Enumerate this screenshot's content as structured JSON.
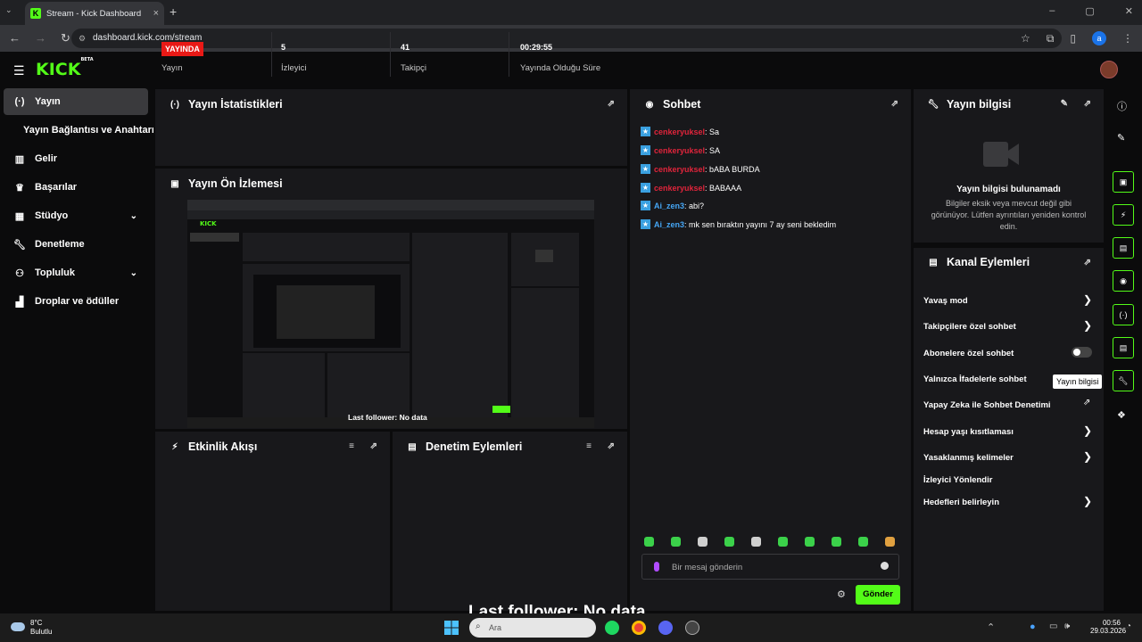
{
  "browser": {
    "tab_title": "Stream - Kick Dashboard",
    "url": "dashboard.kick.com/stream",
    "profile_initial": "a"
  },
  "brand": {
    "logo": "KICK",
    "logo_sup": "BETA",
    "accent": "#53fc18"
  },
  "sidebar": {
    "items": [
      {
        "label": "Yayın",
        "icon": "broadcast-icon"
      },
      {
        "label": "Yayın Bağlantısı ve Anahtarı"
      },
      {
        "label": "Gelir",
        "icon": "chart-icon"
      },
      {
        "label": "Başarılar",
        "icon": "trophy-icon"
      },
      {
        "label": "Stüdyo",
        "icon": "studio-icon"
      },
      {
        "label": "Denetleme",
        "icon": "wrench-icon"
      },
      {
        "label": "Topluluk",
        "icon": "community-icon"
      },
      {
        "label": "Droplar ve ödüller",
        "icon": "drops-icon"
      }
    ]
  },
  "stats": {
    "title": "Yayın İstatistikleri",
    "live_badge": "YAYINDA",
    "items": [
      {
        "value": "",
        "label": "Yayın"
      },
      {
        "value": "5",
        "label": "İzleyici"
      },
      {
        "value": "41",
        "label": "Takipçi"
      },
      {
        "value": "00:29:55",
        "label": "Yayında Olduğu Süre"
      }
    ]
  },
  "preview": {
    "title": "Yayın Ön İzlemesi",
    "overlay": "Last follower: No data"
  },
  "activity": {
    "title": "Etkinlik Akışı"
  },
  "mod_actions": {
    "title": "Denetim Eylemleri"
  },
  "chat": {
    "title": "Sohbet",
    "messages": [
      {
        "user": "cenkeryuksel",
        "text": ": Sa"
      },
      {
        "user": "cenkeryuksel",
        "text": ": SA"
      },
      {
        "user": "cenkeryuksel",
        "text": ": bABA BURDA"
      },
      {
        "user": "cenkeryuksel",
        "text": ": BABAAA"
      },
      {
        "user": "Ai_zen3",
        "text": ": abi?"
      },
      {
        "user": "Ai_zen3",
        "text": ": mk sen bıraktın yayını 7 ay seni bekledim"
      }
    ],
    "placeholder": "Bir mesaj gönderin",
    "send_label": "Gönder"
  },
  "stream_info": {
    "title": "Yayın bilgisi",
    "empty_title": "Yayın bilgisi bulunamadı",
    "empty_text": "Bilgiler eksik veya mevcut değil gibi görünüyor. Lütfen ayrıntıları yeniden kontrol edin."
  },
  "channel_actions": {
    "title": "Kanal Eylemleri",
    "items": [
      "Yavaş mod",
      "Takipçilere özel sohbet",
      "Abonelere özel sohbet",
      "Yalnızca İfadelerle sohbet",
      "Yapay Zeka ile Sohbet Denetimi",
      "Hesap yaşı kısıtlaması",
      "Yasaklanmış kelimeler",
      "İzleyici Yönlendir",
      "Hedefleri belirleyin"
    ]
  },
  "tooltip": "Yayın bilgisi",
  "taskbar": {
    "weather_temp": "8°C",
    "weather_cond": "Bulutlu",
    "search": "Ara",
    "time": "00:56",
    "date": "29.03.2026"
  }
}
